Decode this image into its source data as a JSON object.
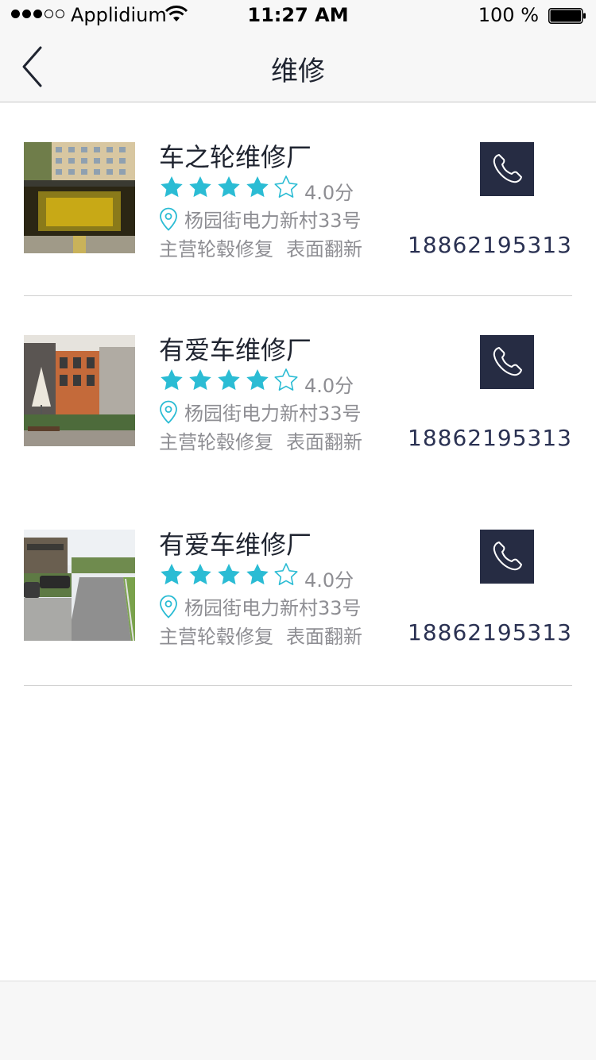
{
  "status_bar": {
    "carrier": "Applidium",
    "time": "11:27 AM",
    "battery": "100 %",
    "signal_full": 3,
    "signal_total": 5,
    "signal_icon": "signal-dots-icon",
    "wifi_icon": "wifi-icon",
    "battery_icon": "battery-icon"
  },
  "nav": {
    "title": "维修",
    "back_icon": "chevron-left-icon"
  },
  "colors": {
    "accent_star": "#2bbcd4",
    "call_button": "#262c43",
    "phone_text": "#2a3152",
    "secondary_text": "#8e8e93"
  },
  "shops": [
    {
      "name": "车之轮维修厂",
      "rating": 4,
      "rating_max": 5,
      "score": "4.0分",
      "address": "杨园街电力新村33号",
      "tags": [
        "主营轮毂修复",
        "表面翻新"
      ],
      "phone": "18862195313",
      "photo": "building-entrance-photo"
    },
    {
      "name": "有爱车维修厂",
      "rating": 4,
      "rating_max": 5,
      "score": "4.0分",
      "address": "杨园街电力新村33号",
      "tags": [
        "主营轮毂修复",
        "表面翻新"
      ],
      "phone": "18862195313",
      "photo": "building-umbrella-photo"
    },
    {
      "name": "有爱车维修厂",
      "rating": 4,
      "rating_max": 5,
      "score": "4.0分",
      "address": "杨园街电力新村33号",
      "tags": [
        "主营轮毂修复",
        "表面翻新"
      ],
      "phone": "18862195313",
      "photo": "parking-road-photo"
    }
  ]
}
